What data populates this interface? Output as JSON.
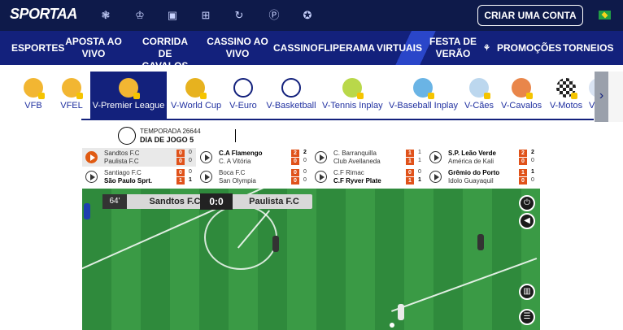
{
  "brand": {
    "logo_text": "SPORTAA"
  },
  "topbar": {
    "icons": [
      "paw-icon",
      "trophy-icon",
      "ticket-icon",
      "basket-icon",
      "spin-icon",
      "p-coin-icon",
      "medal-icon"
    ],
    "create_account_label": "CRIAR UMA CONTA",
    "country_flag": "brazil-flag"
  },
  "nav": {
    "items": [
      {
        "label": "ESPORTES"
      },
      {
        "label": "APOSTA AO VIVO"
      },
      {
        "label": "CORRIDA DE CAVALOS"
      },
      {
        "label": "CASSINO AO VIVO"
      },
      {
        "label": "CASSINO"
      },
      {
        "label": "FLIPERAMA"
      },
      {
        "label": "VIRTUAIS"
      },
      {
        "label": "FESTA DE VERÃO"
      },
      {
        "label": "PROMOÇÕES"
      },
      {
        "label": "TORNEIOS"
      }
    ]
  },
  "virtual_tabs": [
    {
      "label": "VFB"
    },
    {
      "label": "VFEL"
    },
    {
      "label": "V-Premier League"
    },
    {
      "label": "V-World Cup"
    },
    {
      "label": "V-Euro"
    },
    {
      "label": "V-Basketball"
    },
    {
      "label": "V-Tennis Inplay"
    },
    {
      "label": "V-Baseball Inplay"
    },
    {
      "label": "V-Cães"
    },
    {
      "label": "V-Cavalos"
    },
    {
      "label": "V-Motos"
    },
    {
      "label": "V-Ta"
    }
  ],
  "game": {
    "season_label": "TEMPORADA 26644",
    "matchday_label": "DIA DE JOGO 5",
    "matches": [
      {
        "home": "Sandtos F.C",
        "away": "Paulista F.C",
        "hs": "0",
        "as": "0",
        "ha": "0",
        "aa": "0"
      },
      {
        "home": "C.A Flamengo",
        "away": "C. A Vitória",
        "hs": "2",
        "as": "0",
        "ha": "2",
        "aa": "0"
      },
      {
        "home": "C. Barranquilla",
        "away": "Club Avellaneda",
        "hs": "1",
        "as": "1",
        "ha": "1",
        "aa": "1"
      },
      {
        "home": "S.P. Leão Verde",
        "away": "América de Kali",
        "hs": "2",
        "as": "0",
        "ha": "2",
        "aa": "0"
      },
      {
        "home": "Santiago F.C",
        "away": "São Paulo Sprt.",
        "hs": "0",
        "as": "1",
        "ha": "0",
        "aa": "1"
      },
      {
        "home": "Boca F.C",
        "away": "San Olympia",
        "hs": "0",
        "as": "0",
        "ha": "0",
        "aa": "0"
      },
      {
        "home": "C.F Rimac",
        "away": "C.F Ryver Plate",
        "hs": "0",
        "as": "1",
        "ha": "0",
        "aa": "1"
      },
      {
        "home": "Grêmio do Porto",
        "away": "Idolo Guayaquil",
        "hs": "1",
        "as": "0",
        "ha": "1",
        "aa": "0"
      }
    ],
    "scoreboard": {
      "minute": "64'",
      "home": "Sandtos F.C",
      "score": "0:0",
      "away": "Paulista F.C"
    },
    "controls": [
      "power-icon",
      "volume-icon",
      "stats-icon",
      "list-icon"
    ]
  }
}
